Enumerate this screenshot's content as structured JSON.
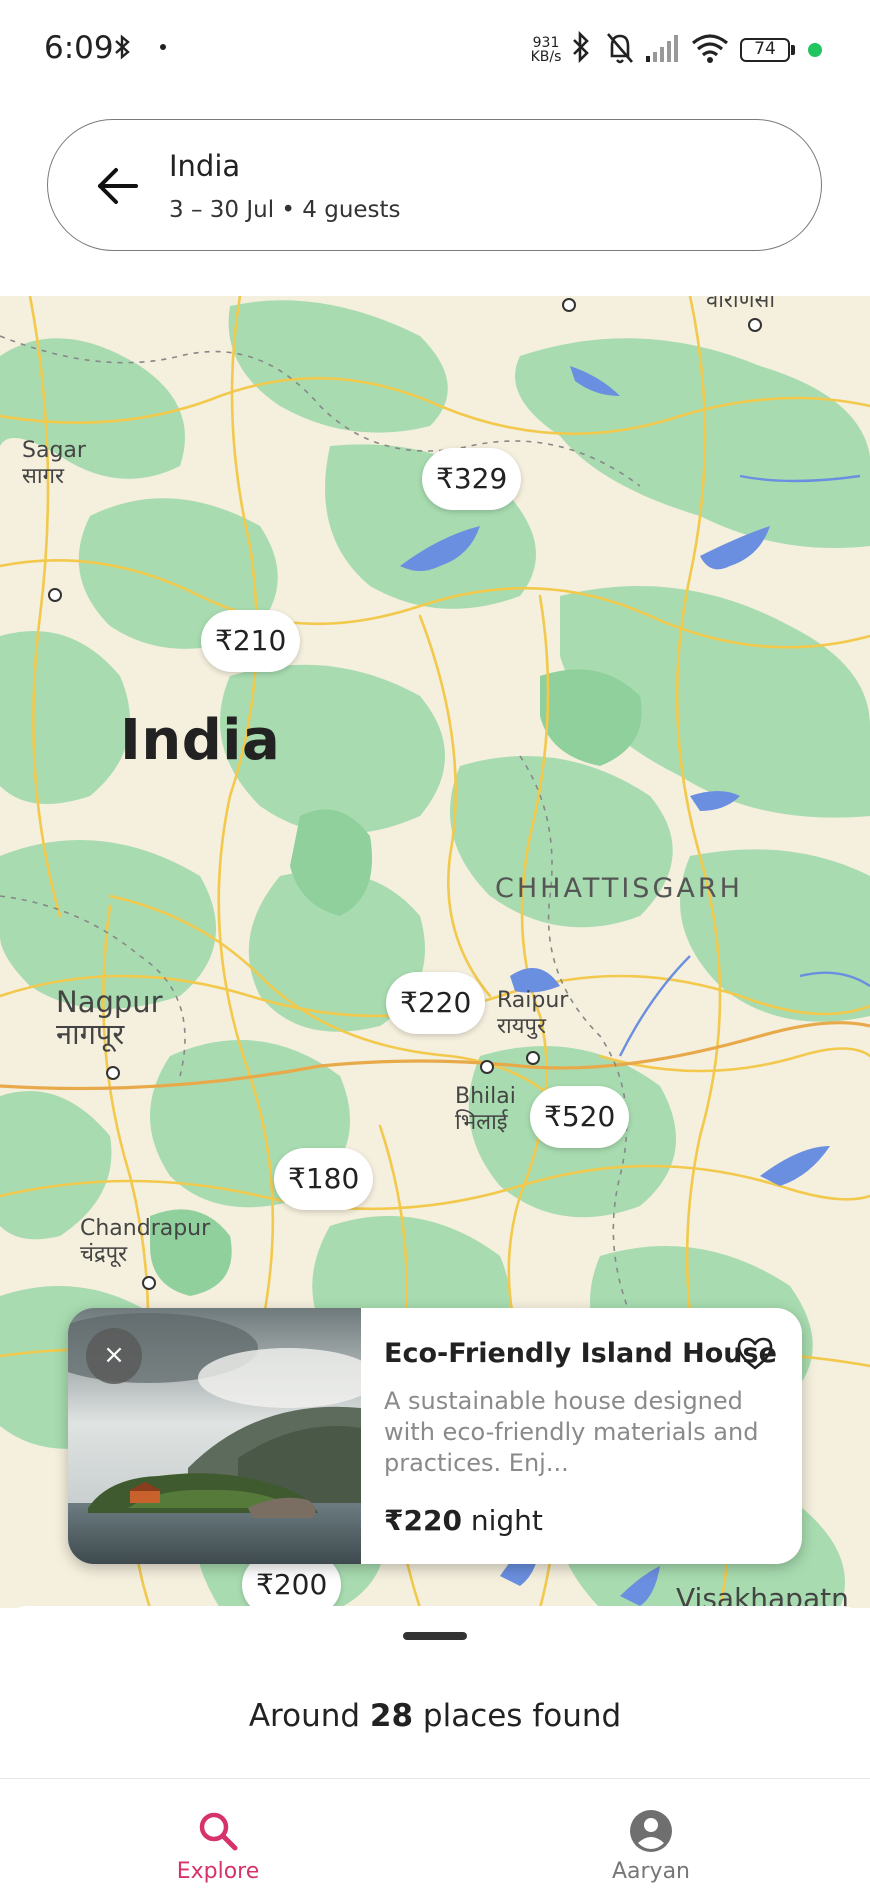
{
  "status_bar": {
    "time": "6:09",
    "net_rate_top": "931",
    "net_rate_bottom": "KB/s",
    "battery": "74"
  },
  "search": {
    "title": "India",
    "subtitle": "3 – 30 Jul • 4 guests"
  },
  "map": {
    "labels": {
      "country": "India",
      "state": "CHHATTISGARH",
      "sagar_en": "Sagar",
      "sagar_hi": "सागर",
      "nagpur_en": "Nagpur",
      "nagpur_hi": "नागपूर",
      "raipur_en": "Raipur",
      "raipur_hi": "रायपुर",
      "bhilai_en": "Bhilai",
      "bhilai_hi": "भिलाई",
      "chandrapur_en": "Chandrapur",
      "chandrapur_hi": "चंद्रपूर",
      "varanasi_hi": "वाराणसी",
      "visakhapatnam_partial": "Visakhapatn"
    },
    "prices": {
      "p1": "₹329",
      "p2": "₹210",
      "p3": "₹220",
      "p4": "₹520",
      "p5": "₹180",
      "p6": "₹200"
    }
  },
  "card": {
    "title": "Eco-Friendly Island House",
    "description": "A sustainable house designed with eco-friendly materials and practices. Enj...",
    "price": "₹220",
    "price_unit": "night",
    "close_label": "×"
  },
  "results": {
    "prefix": "Around",
    "count": "28",
    "suffix": "places found"
  },
  "nav": {
    "explore_label": "Explore",
    "profile_label": "Aaryan",
    "active_color": "#d6336c",
    "inactive_color": "#777777"
  }
}
